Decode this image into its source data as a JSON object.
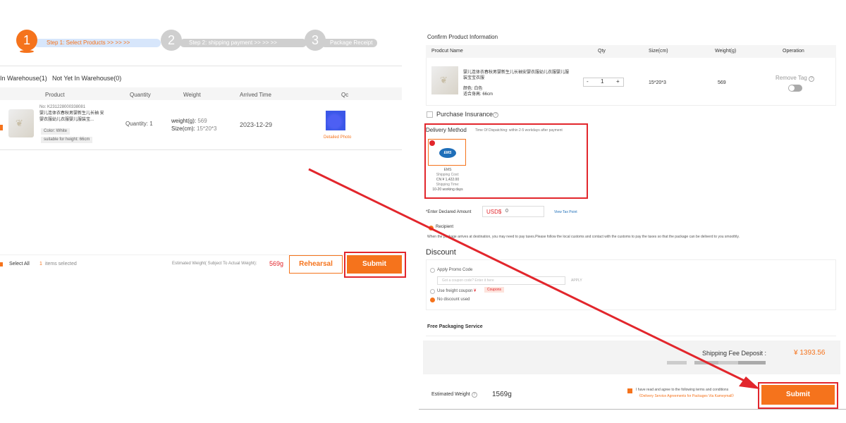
{
  "steps": [
    {
      "num": "1",
      "label": "Step 1: Select Products >> >> >>"
    },
    {
      "num": "2",
      "label": "Step 2: shipping payment >> >> >>"
    },
    {
      "num": "3",
      "label": "Package Receipt"
    }
  ],
  "tabs": [
    "In Warehouse(1)",
    "Not Yet In Warehouse(0)"
  ],
  "table": {
    "headers": [
      "Product",
      "Quantity",
      "Weight",
      "Arrived Time",
      "Qc"
    ],
    "row": {
      "no": "No: K231228000338081",
      "title": "婴儿连体衣春秋男婴新生儿长袖 安婴衣服幼儿衣服婴儿服装宝...",
      "color": "Color: White",
      "size": "suitable for height: 66cm",
      "quantity": "Quantity: 1",
      "weight_label": "weight(g):",
      "weight_value": "569",
      "size_label": "Size(cm):",
      "size_value": "15*20*3",
      "arrived": "2023-12-29",
      "qc_link": "Detailed Photo"
    }
  },
  "footer": {
    "select_all": "Select All",
    "selected_count": "1",
    "selected_text": "items selected",
    "est_label": "Estimated Weight( Subject To Actual Weight):",
    "est_value": "569g",
    "rehearsal": "Rehearsal",
    "submit": "Submit"
  },
  "confirm": {
    "title": "Confirm Product Information",
    "headers": [
      "Prodcut Name",
      "Qty",
      "Size(cm)",
      "Weight(g)",
      "Operation"
    ],
    "product_title": "婴儿连体衣春秋男婴新生儿长袖安婴衣服幼儿衣服婴儿服装宝宝衣服",
    "product_color": "颜色: 白色",
    "product_size": "适合身高: 66cm",
    "minus": "-",
    "qty": "1",
    "plus": "+",
    "size": "15*20*3",
    "weight": "569",
    "remove_tag": "Remove Tag",
    "info_icon": "?"
  },
  "insurance": {
    "label": "Purchase Insurance",
    "icon": "?"
  },
  "delivery": {
    "title": "Delivery Method",
    "dispatch": "Time Of Dispatching: within 2-5 workdays after payment",
    "logo": "EMS",
    "name": "EMS",
    "cost_label": "Shipping Cost:",
    "cost_value": "CN ¥ 1,422.00",
    "time_label": "Shipping Time:",
    "time_value": "10-20 working days"
  },
  "declared": {
    "label": "*Enter Declared Amount",
    "currency": "USD$",
    "value": "0",
    "tax_link": "View Tax Point"
  },
  "recipient": {
    "label": "Recipient",
    "note": "When the package arrives at destination, you may need to pay taxes.Please follow the local customs and contact with the customs to pay the taxes so that the package can be deliverd to you smoothly."
  },
  "discount": {
    "title": "Discount",
    "promo_label": "Apply Promo Code",
    "promo_placeholder": "Got a coupon code? Enter it here",
    "apply": "APPLY",
    "freight_label": "Use freight coupon",
    "freight_symbol": "¥",
    "coupons": "Coupons",
    "none_label": "No discount used"
  },
  "packaging": {
    "title": "Free Packaging Service"
  },
  "deposit": {
    "label": "Shipping Fee Deposit :",
    "value": "¥ 1393.56"
  },
  "bottom": {
    "est_label": "Estimated Weight",
    "est_value": "1569g",
    "agree_1": "I have read and agree to the following terms and conditions",
    "agree_2": "《Delivery Service Agreements for Packages Via Kameymall》",
    "submit": "Submit"
  },
  "colors": {
    "accent": "#f5731c",
    "highlight": "#e2262c",
    "step_active": "#d7e6fb",
    "step_inactive": "#cfcfcf"
  }
}
